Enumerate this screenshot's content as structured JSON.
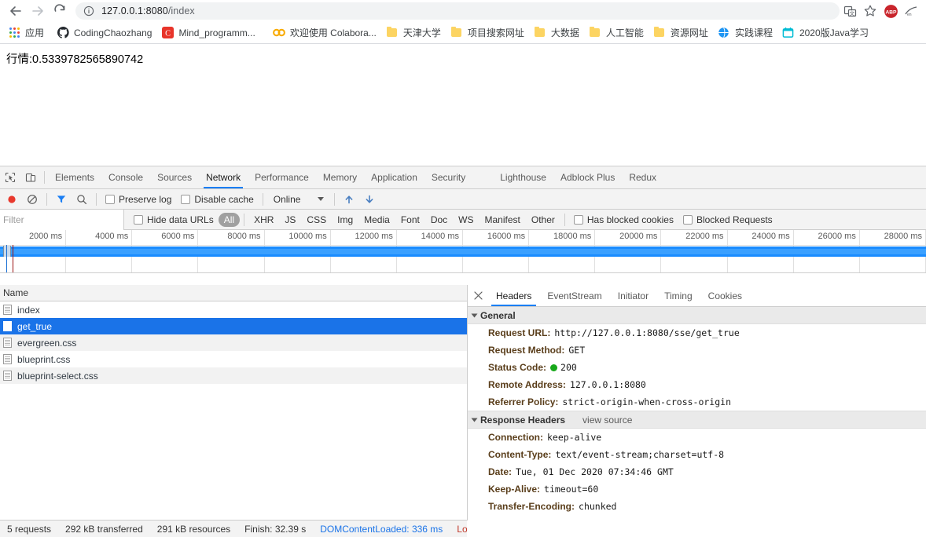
{
  "browser": {
    "back_icon": "back-arrow-icon",
    "forward_icon": "forward-arrow-icon",
    "reload_icon": "reload-icon",
    "info_icon": "site-info-icon",
    "url_host": "127.0.0.1:8080",
    "url_path": "/index",
    "actions": [
      {
        "name": "translate-icon",
        "label": "translate"
      },
      {
        "name": "bookmark-star-icon",
        "label": "bookmark"
      },
      {
        "name": "adblock-plus-icon",
        "label": "ABP"
      },
      {
        "name": "extension-icon",
        "label": "ext"
      }
    ]
  },
  "bookmarks": {
    "apps_label": "应用",
    "items": [
      {
        "label": "CodingChaozhang",
        "icon": "github-icon"
      },
      {
        "label": "Mind_programm...",
        "icon": "csdn-icon"
      },
      {
        "label": "欢迎使用 Colabora...",
        "icon": "colab-icon"
      },
      {
        "label": "天津大学",
        "icon": "folder-icon"
      },
      {
        "label": "项目搜索网址",
        "icon": "folder-icon"
      },
      {
        "label": "大数据",
        "icon": "folder-icon"
      },
      {
        "label": "人工智能",
        "icon": "folder-icon"
      },
      {
        "label": "资源网址",
        "icon": "folder-icon"
      },
      {
        "label": "实践课程",
        "icon": "globe-blue-icon"
      },
      {
        "label": "2020版Java学习",
        "icon": "calendar-cyan-icon"
      }
    ]
  },
  "page": {
    "text": "行情:0.5339782565890742"
  },
  "devtools": {
    "tabs": [
      {
        "label": "Elements",
        "active": false
      },
      {
        "label": "Console",
        "active": false
      },
      {
        "label": "Sources",
        "active": false
      },
      {
        "label": "Network",
        "active": true
      },
      {
        "label": "Performance",
        "active": false
      },
      {
        "label": "Memory",
        "active": false
      },
      {
        "label": "Application",
        "active": false
      },
      {
        "label": "Security",
        "active": false
      },
      {
        "label": "Lighthouse",
        "active": false,
        "gap": true
      },
      {
        "label": "Adblock Plus",
        "active": false
      },
      {
        "label": "Redux",
        "active": false
      }
    ],
    "toolbar": {
      "record_icon": "record-stop-icon",
      "clear_icon": "clear-icon",
      "filter_icon": "filter-funnel-icon",
      "search_icon": "search-icon",
      "preserve_log": "Preserve log",
      "disable_cache": "Disable cache",
      "throttle_value": "Online",
      "import_icon": "import-har-icon",
      "export_icon": "export-har-icon"
    },
    "filterbar": {
      "placeholder": "Filter",
      "hide_data_urls": "Hide data URLs",
      "types": [
        "All",
        "XHR",
        "JS",
        "CSS",
        "Img",
        "Media",
        "Font",
        "Doc",
        "WS",
        "Manifest",
        "Other"
      ],
      "selected_type": "All",
      "has_blocked_cookies": "Has blocked cookies",
      "blocked_requests": "Blocked Requests"
    },
    "timeline": {
      "ticks": [
        "2000 ms",
        "4000 ms",
        "6000 ms",
        "8000 ms",
        "10000 ms",
        "12000 ms",
        "14000 ms",
        "16000 ms",
        "18000 ms",
        "20000 ms",
        "22000 ms",
        "24000 ms",
        "26000 ms",
        "28000 ms"
      ]
    },
    "requests": {
      "column_name": "Name",
      "rows": [
        {
          "name": "index",
          "selected": false
        },
        {
          "name": "get_true",
          "selected": true
        },
        {
          "name": "evergreen.css",
          "selected": false
        },
        {
          "name": "blueprint.css",
          "selected": false
        },
        {
          "name": "blueprint-select.css",
          "selected": false
        }
      ]
    },
    "detail": {
      "close_icon": "close-icon",
      "tabs": [
        {
          "label": "Headers",
          "active": true
        },
        {
          "label": "EventStream",
          "active": false
        },
        {
          "label": "Initiator",
          "active": false
        },
        {
          "label": "Timing",
          "active": false
        },
        {
          "label": "Cookies",
          "active": false
        }
      ],
      "general_title": "General",
      "general": [
        {
          "name": "Request URL:",
          "value": "http://127.0.0.1:8080/sse/get_true"
        },
        {
          "name": "Request Method:",
          "value": "GET"
        },
        {
          "name": "Status Code:",
          "value": "200",
          "status": true
        },
        {
          "name": "Remote Address:",
          "value": "127.0.0.1:8080"
        },
        {
          "name": "Referrer Policy:",
          "value": "strict-origin-when-cross-origin"
        }
      ],
      "response_title": "Response Headers",
      "view_source": "view source",
      "response": [
        {
          "name": "Connection:",
          "value": "keep-alive"
        },
        {
          "name": "Content-Type:",
          "value": "text/event-stream;charset=utf-8"
        },
        {
          "name": "Date:",
          "value": "Tue, 01 Dec 2020 07:34:46 GMT"
        },
        {
          "name": "Keep-Alive:",
          "value": "timeout=60"
        },
        {
          "name": "Transfer-Encoding:",
          "value": "chunked"
        }
      ]
    },
    "status": {
      "requests": "5 requests",
      "transferred": "292 kB transferred",
      "resources": "291 kB resources",
      "finish": "Finish: 32.39 s",
      "dcl": "DOMContentLoaded: 336 ms",
      "load": "Load"
    }
  },
  "colors": {
    "accent": "#1a73e8",
    "tab_underline": "#1a7ef4",
    "timeline_bar": "#1a8cff",
    "status_ok": "#17a81a",
    "dcl_line": "#1a6fd4",
    "load_line": "#9b1111",
    "folder": "#fcd462"
  }
}
